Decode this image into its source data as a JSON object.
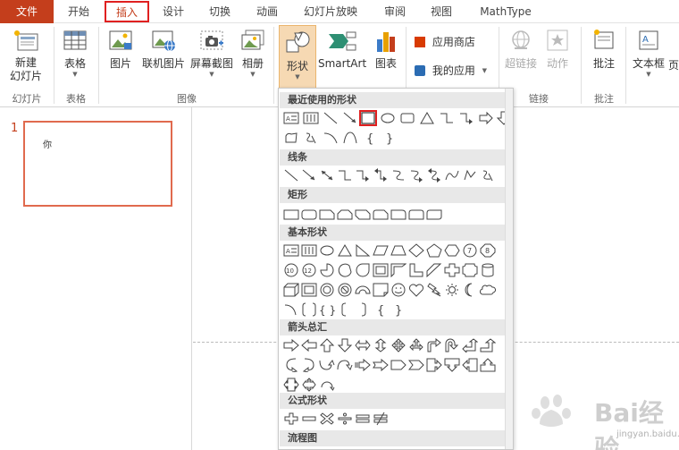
{
  "menu": {
    "file": "文件",
    "tabs": [
      "开始",
      "插入",
      "设计",
      "切换",
      "动画",
      "幻灯片放映",
      "审阅",
      "视图",
      "MathType"
    ]
  },
  "ribbon": {
    "new_slide_line1": "新建",
    "new_slide_line2": "幻灯片",
    "table": "表格",
    "picture": "图片",
    "online_picture": "联机图片",
    "screenshot": "屏幕截图",
    "album": "相册",
    "shapes": "形状",
    "smartart": "SmartArt",
    "chart": "图表",
    "app_store": "应用商店",
    "my_apps": "我的应用",
    "hyperlink": "超链接",
    "action": "动作",
    "comment": "批注",
    "textbox": "文本框",
    "more": "页",
    "groups": {
      "slides": "幻灯片",
      "tables": "表格",
      "images": "图像",
      "links": "链接",
      "comments": "批注"
    }
  },
  "slide_panel": {
    "number": "1",
    "thumb_text": "你"
  },
  "shapes_menu": {
    "recent": "最近使用的形状",
    "lines": "线条",
    "rectangles": "矩形",
    "basic": "基本形状",
    "arrows": "箭头总汇",
    "equation": "公式形状",
    "flowchart": "流程图"
  },
  "watermark": {
    "brand": "Bai经验",
    "url": "jingyan.baidu.com"
  },
  "colors": {
    "accent": "#c43e1c",
    "highlight": "#e02020",
    "shapes_active": "#f6d9b3"
  }
}
